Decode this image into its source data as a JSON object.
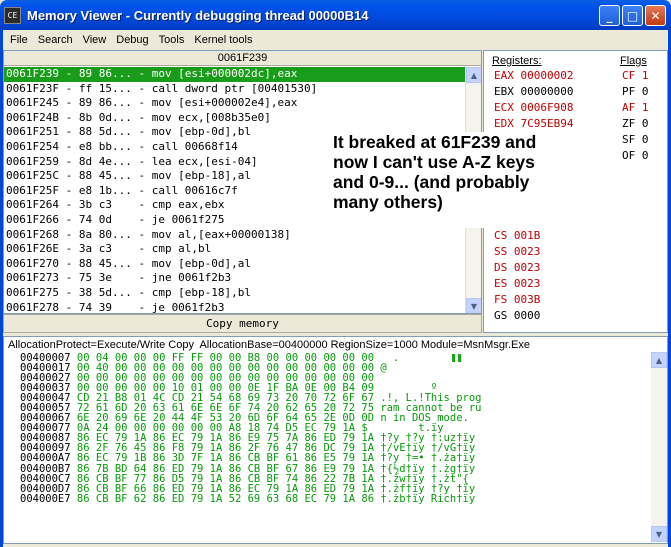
{
  "window": {
    "title": "Memory Viewer - Currently debugging thread 00000B14",
    "icon_label": "CE",
    "minimize": "_",
    "maximize": "□",
    "close": "✕"
  },
  "menu": [
    "File",
    "Search",
    "View",
    "Debug",
    "Tools",
    "Kernel tools"
  ],
  "disassembly": {
    "header": "0061F239",
    "rows": [
      "0061F239 - 89 86... - mov [esi+000002dc],eax",
      "0061F23F - ff 15... - call dword ptr [00401530]",
      "0061F245 - 89 86... - mov [esi+000002e4],eax",
      "0061F24B - 8b 0d... - mov ecx,[008b35e0]",
      "0061F251 - 88 5d... - mov [ebp-0d],bl",
      "0061F254 - e8 bb... - call 00668f14",
      "0061F259 - 8d 4e... - lea ecx,[esi-04]",
      "0061F25C - 88 45... - mov [ebp-18],al",
      "0061F25F - e8 1b... - call 00616c7f",
      "0061F264 - 3b c3    - cmp eax,ebx",
      "0061F266 - 74 0d    - je 0061f275",
      "0061F268 - 8a 80... - mov al,[eax+00000138]",
      "0061F26E - 3a c3    - cmp al,bl",
      "0061F270 - 88 45... - mov [ebp-0d],al",
      "0061F273 - 75 3e    - jne 0061f2b3",
      "0061F275 - 38 5d... - cmp [ebp-18],bl",
      "0061F278 - 74 39    - je 0061f2b3"
    ],
    "copy_button": "Copy memory"
  },
  "registers": {
    "header": "Registers:",
    "flags_header": "Flags",
    "regs": [
      {
        "text": "EAX 00000002",
        "color": "red"
      },
      {
        "text": "EBX 00000000",
        "color": "black"
      },
      {
        "text": "ECX 0006F908",
        "color": "red"
      },
      {
        "text": "EDX 7C95EB94",
        "color": "red"
      },
      {
        "text": "CS 001B",
        "color": "red"
      },
      {
        "text": "SS 0023",
        "color": "red"
      },
      {
        "text": "DS 0023",
        "color": "red"
      },
      {
        "text": "ES 0023",
        "color": "red"
      },
      {
        "text": "FS 003B",
        "color": "red"
      },
      {
        "text": "GS 0000",
        "color": "black"
      }
    ],
    "flags": [
      {
        "text": "CF 1",
        "color": "red"
      },
      {
        "text": "PF 0",
        "color": "black"
      },
      {
        "text": "AF 1",
        "color": "red"
      },
      {
        "text": "ZF 0",
        "color": "black"
      },
      {
        "text": "SF 0",
        "color": "black"
      },
      {
        "text": "OF 0",
        "color": "black"
      }
    ]
  },
  "annotation": "It breaked at 61F239 and\nnow I can't use A-Z keys\nand 0-9... (and probably\nmany others)",
  "hexview": {
    "header": "AllocationProtect=Execute/Write Copy  AllocationBase=00400000 RegionSize=1000 Module=MsnMsgr.Exe",
    "rows": [
      {
        "addr": "00400007",
        "bytes": "00 04 00 00 00 FF FF 00 00 B8 00 00 00 00 00 00",
        "ascii": "  .           "
      },
      {
        "addr": "00400017",
        "bytes": "00 40 00 00 00 00 00 00 00 00 00 00 00 00 00 00",
        "ascii": "@               "
      },
      {
        "addr": "00400027",
        "bytes": "00 00 00 00 00 00 00 00 00 00 00 00 00 00 00 00",
        "ascii": ""
      },
      {
        "addr": "00400037",
        "bytes": "00 00 00 00 00 10 01 00 00 0E 1F BA 0E 00 B4 09",
        "ascii": "        º    "
      },
      {
        "addr": "00400047",
        "bytes": "CD 21 B8 01 4C CD 21 54 68 69 73 20 70 72 6F 67",
        "ascii": ".!, L.!This prog"
      },
      {
        "addr": "00400057",
        "bytes": "72 61 6D 20 63 61 6E 6E 6F 74 20 62 65 20 72 75",
        "ascii": "ram cannot be ru"
      },
      {
        "addr": "00400067",
        "bytes": "6E 20 69 6E 20 44 4F 53 20 6D 6F 64 65 2E 0D 0D",
        "ascii": "n in DOS mode."
      },
      {
        "addr": "00400077",
        "bytes": "0A 24 00 00 00 00 00 00 A8 18 74 D5 EC 79 1A",
        "ascii": "$        t.ïy"
      },
      {
        "addr": "00400087",
        "bytes": "86 EC 79 1A 86 EC 79 1A 86 E9 75 7A 86 ED 79 1A",
        "ascii": "†?y †?y †:uz†ïy"
      },
      {
        "addr": "00400097",
        "bytes": "86 2F 76 45 86 F8 79 1A 86 2F 76 47 86 DC 79 1A",
        "ascii": "†/vE†ïy †/vG†ïy"
      },
      {
        "addr": "004000A7",
        "bytes": "86 EC 79 1B 86 3D 7F 1A 86 CB BF 61 86 E5 79 1A",
        "ascii": "†?y †=• †.ża†ïy"
      },
      {
        "addr": "004000B7",
        "bytes": "86 7B BD 64 86 ED 79 1A 86 CB BF 67 86 E9 79 1A",
        "ascii": "†{½d†ïy †.żg†ïy"
      },
      {
        "addr": "004000C7",
        "bytes": "86 CB BF 77 86 D5 79 1A 86 CB BF 74 86 22 7B 1A",
        "ascii": "†.żw†ïy †.żt\"{"
      },
      {
        "addr": "004000D7",
        "bytes": "86 CB BF 66 86 ED 79 1A 86 EC 79 1A 86 ED 79 1A",
        "ascii": "†.żf†ïy †?y †ïy"
      },
      {
        "addr": "004000E7",
        "bytes": "86 CB BF 62 86 ED 79 1A 52 69 63 68 EC 79 1A 86",
        "ascii": "†.żb†ïy Rich†ïy"
      }
    ]
  }
}
